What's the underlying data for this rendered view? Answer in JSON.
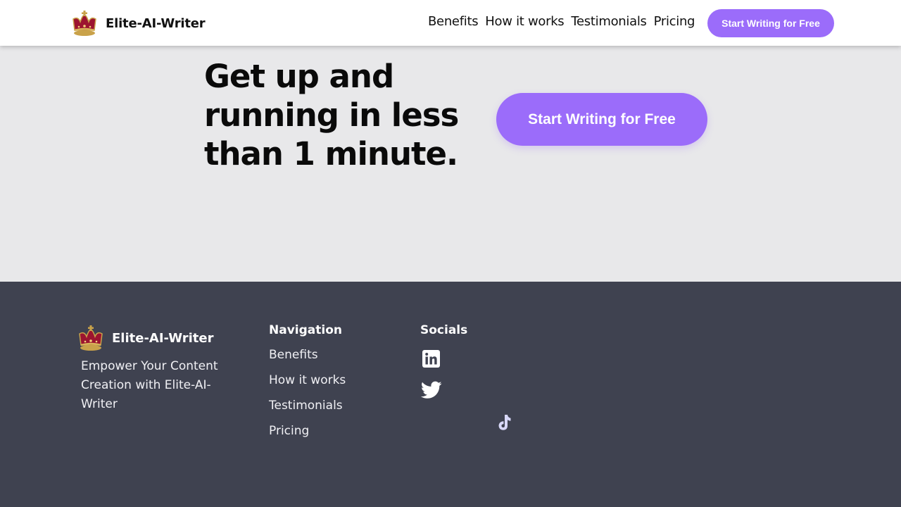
{
  "header": {
    "brand_name": "Elite-AI-Writer",
    "logo_icon": "crown-icon",
    "nav": [
      "Benefits",
      "How it works",
      "Testimonials",
      "Pricing"
    ],
    "cta_label": "Start Writing for Free"
  },
  "hero": {
    "title": "Get up and running in less than 1 minute.",
    "cta_label": "Start Writing for Free"
  },
  "footer": {
    "brand_name": "Elite-AI-Writer",
    "tagline": "Empower Your Content Creation with Elite-AI-Writer",
    "navigation": {
      "title": "Navigation",
      "items": [
        "Benefits",
        "How it works",
        "Testimonials",
        "Pricing"
      ]
    },
    "socials": {
      "title": "Socials",
      "icons": [
        "linkedin-icon",
        "twitter-icon",
        "tiktok-icon"
      ]
    }
  },
  "colors": {
    "accent": "#9b6cfa",
    "hero_bg": "#e8e8ea",
    "footer_bg": "#3f4250",
    "tiktok": "#d8d8f8"
  }
}
